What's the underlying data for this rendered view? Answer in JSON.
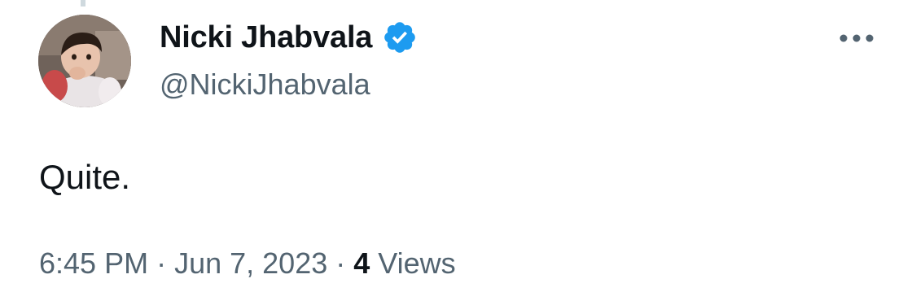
{
  "tweet": {
    "author": {
      "display_name": "Nicki Jhabvala",
      "handle": "@NickiJhabvala",
      "verified": true,
      "verified_color": "#1d9bf0"
    },
    "text": "Quite.",
    "time": "6:45 PM",
    "separator": "·",
    "date": "Jun 7, 2023",
    "views_count": "4",
    "views_label": "Views",
    "more_icon": "more-horizontal-icon"
  }
}
